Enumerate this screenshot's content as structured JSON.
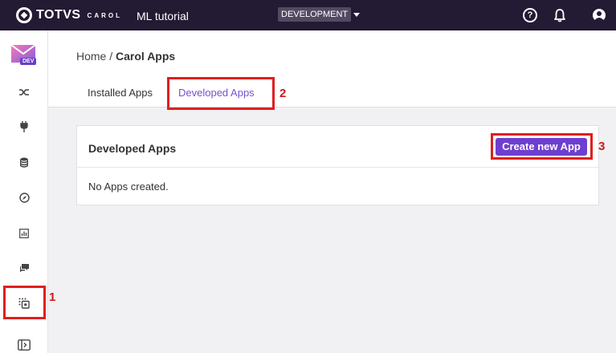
{
  "topbar": {
    "brand": "TOTVS",
    "brand_sub": "CAROL",
    "tenant": "ML tutorial",
    "environment": "DEVELOPMENT",
    "icons": [
      "help-icon",
      "bell-icon",
      "user-icon"
    ]
  },
  "sidebar": {
    "badge": "DEV",
    "items": [
      {
        "icon": "shuffle-icon"
      },
      {
        "icon": "plug-icon"
      },
      {
        "icon": "database-icon"
      },
      {
        "icon": "compass-icon"
      },
      {
        "icon": "chart-icon"
      },
      {
        "icon": "chat-icon"
      },
      {
        "icon": "apps-icon"
      },
      {
        "icon": "expand-icon"
      }
    ]
  },
  "breadcrumb": {
    "home": "Home",
    "separator": "/",
    "current": "Carol Apps"
  },
  "tabs": [
    {
      "label": "Installed Apps",
      "active": false
    },
    {
      "label": "Developed Apps",
      "active": true
    }
  ],
  "card": {
    "title": "Developed Apps",
    "create_label": "Create new App",
    "empty_message": "No Apps created."
  },
  "annotations": [
    "1",
    "2",
    "3"
  ],
  "colors": {
    "topbar": "#231a33",
    "accent": "#6e3fcf",
    "annotation": "#e01e1e"
  }
}
